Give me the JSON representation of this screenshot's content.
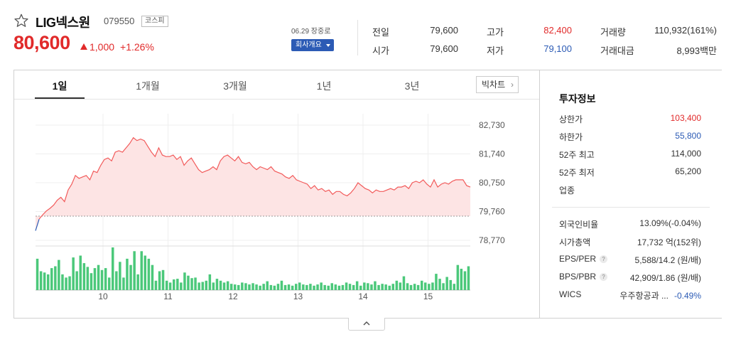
{
  "stock": {
    "name": "LIG넥스원",
    "code": "079550",
    "market": "코스피",
    "price": "80,600",
    "change": "1,000",
    "change_pct": "+1.26%",
    "date_label": "06.29 장중로",
    "company_button": "회사개요"
  },
  "quotes": {
    "prev_close_label": "전일",
    "prev_close": "79,600",
    "open_label": "시가",
    "open": "79,600",
    "high_label": "고가",
    "high": "82,400",
    "low_label": "저가",
    "low": "79,100",
    "volume_label": "거래량",
    "volume": "110,932(161%)",
    "amount_label": "거래대금",
    "amount": "8,993백만"
  },
  "tabs": [
    "1일",
    "1개월",
    "3개월",
    "1년",
    "3년"
  ],
  "big_chart_button": "빅차트",
  "investment": {
    "title": "투자정보",
    "rows": [
      {
        "label": "상한가",
        "value": "103,400"
      },
      {
        "label": "하한가",
        "value": "55,800"
      },
      {
        "label": "52주 최고",
        "value": "114,000"
      },
      {
        "label": "52주 최저",
        "value": "65,200"
      },
      {
        "label": "업종",
        "value": ""
      },
      {
        "label": "외국인비율",
        "value": "13.09%(-0.04%)"
      },
      {
        "label": "시가총액",
        "value": "17,732 억(152위)"
      },
      {
        "label": "EPS/PER",
        "value": "5,588/14.2 (원/배)"
      },
      {
        "label": "BPS/PBR",
        "value": "42,909/1.86 (원/배)"
      },
      {
        "label": "WICS",
        "value": "우주항공과 ...",
        "value2": "-0.49%"
      }
    ]
  },
  "colors": {
    "up": "#e12a2a",
    "down": "#2c5bb5",
    "line": "#f25a5a",
    "area": "#fde4e4",
    "volume": "#4bc87a"
  },
  "chart_data": {
    "type": "area",
    "yticks": [
      "82,730",
      "81,740",
      "80,750",
      "79,760",
      "78,770"
    ],
    "ylim": [
      78770,
      82730
    ],
    "prev_close": 79600,
    "xticks": [
      "10",
      "11",
      "12",
      "13",
      "14",
      "15"
    ],
    "price_series": [
      79100,
      79500,
      79650,
      79780,
      79870,
      79980,
      80150,
      80250,
      80100,
      80500,
      80700,
      81000,
      80900,
      80950,
      81000,
      80850,
      81150,
      81100,
      81350,
      81550,
      81600,
      81500,
      81800,
      81850,
      81800,
      81950,
      82100,
      82300,
      82200,
      82250,
      82200,
      82000,
      81800,
      81650,
      81950,
      81700,
      81650,
      81650,
      81700,
      81550,
      81650,
      81350,
      81500,
      81600,
      81400,
      81200,
      81100,
      81150,
      81200,
      81300,
      81200,
      81500,
      81650,
      81700,
      81600,
      81500,
      81650,
      81450,
      81400,
      81450,
      81300,
      81200,
      81300,
      81250,
      81200,
      81300,
      81150,
      81100,
      81050,
      80950,
      80900,
      81000,
      80850,
      80800,
      80750,
      80700,
      80550,
      80650,
      80500,
      80550,
      80450,
      80500,
      80350,
      80450,
      80450,
      80350,
      80300,
      80400,
      80550,
      80750,
      80650,
      80550,
      80500,
      80400,
      80500,
      80450,
      80450,
      80500,
      80550,
      80500,
      80600,
      80600,
      80650,
      80550,
      80750,
      80800,
      80750,
      80850,
      80700,
      80600,
      80850,
      80600,
      80700,
      80750,
      80700,
      80800,
      80850,
      80850,
      80850,
      80650,
      80600
    ],
    "volume_series": [
      50,
      30,
      28,
      25,
      35,
      38,
      48,
      25,
      20,
      22,
      52,
      30,
      55,
      43,
      37,
      27,
      35,
      40,
      32,
      35,
      20,
      68,
      30,
      45,
      20,
      50,
      40,
      62,
      25,
      62,
      55,
      50,
      40,
      15,
      30,
      32,
      15,
      12,
      17,
      18,
      12,
      28,
      23,
      19,
      20,
      12,
      13,
      15,
      25,
      12,
      18,
      15,
      12,
      14,
      10,
      9,
      8,
      12,
      11,
      9,
      11,
      9,
      7,
      10,
      14,
      8,
      7,
      10,
      15,
      8,
      9,
      7,
      10,
      12,
      9,
      8,
      10,
      7,
      9,
      12,
      8,
      7,
      11,
      9,
      7,
      8,
      12,
      10,
      8,
      14,
      7,
      12,
      11,
      9,
      14,
      8,
      10,
      9,
      7,
      10,
      15,
      12,
      22,
      11,
      8,
      10,
      8,
      15,
      12,
      10,
      12,
      26,
      18,
      11,
      21,
      16,
      10,
      40,
      34,
      30,
      38
    ]
  }
}
